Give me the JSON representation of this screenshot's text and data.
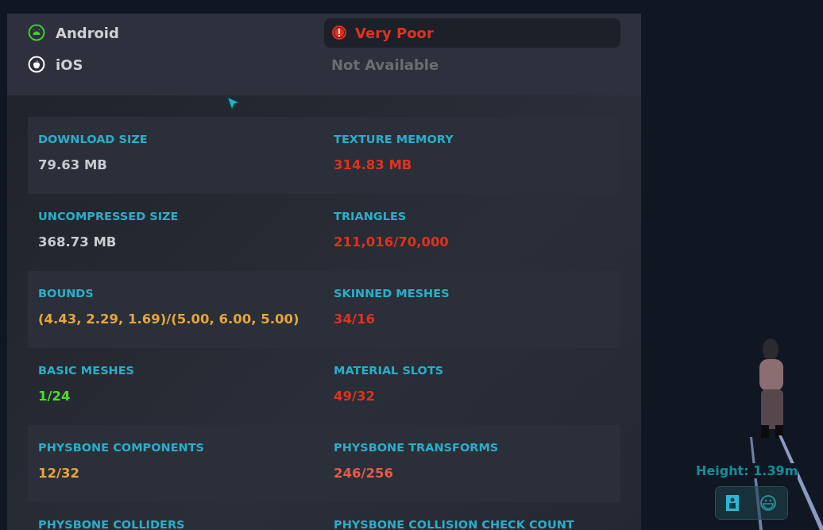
{
  "platforms": [
    {
      "kind": "android",
      "name": "Android",
      "color": "#e0321e",
      "status": "Very Poor",
      "alert": true
    },
    {
      "kind": "ios",
      "name": "iOS",
      "color": "#6b6d73",
      "status": "Not Available",
      "alert": false
    }
  ],
  "stats": [
    {
      "label": "DOWNLOAD SIZE",
      "value": "79.63 MB",
      "color": "#c9cbcf"
    },
    {
      "label": "TEXTURE MEMORY",
      "value": "314.83 MB",
      "color": "#e0321e"
    },
    {
      "label": "UNCOMPRESSED SIZE",
      "value": "368.73 MB",
      "color": "#c9cbcf"
    },
    {
      "label": "TRIANGLES",
      "value": "211,016/70,000",
      "color": "#e0321e"
    },
    {
      "label": "BOUNDS",
      "value": "(4.43, 2.29, 1.69)/(5.00, 6.00, 5.00)",
      "color": "#e8a63a"
    },
    {
      "label": "SKINNED MESHES",
      "value": "34/16",
      "color": "#e0321e"
    },
    {
      "label": "BASIC MESHES",
      "value": "1/24",
      "color": "#4bdc2b"
    },
    {
      "label": "MATERIAL SLOTS",
      "value": "49/32",
      "color": "#e0321e"
    },
    {
      "label": "PHYSBONE COMPONENTS",
      "value": "12/32",
      "color": "#e8a63a"
    },
    {
      "label": "PHYSBONE TRANSFORMS",
      "value": "246/256",
      "color": "#e85a4a"
    },
    {
      "label": "PHYSBONE COLLIDERS"
    },
    {
      "label": "PHYSBONE COLLISION CHECK COUNT"
    }
  ],
  "preview": {
    "height": "Height: 1.39m",
    "modes": [
      {
        "kind": "info",
        "selected": true
      },
      {
        "kind": "face",
        "selected": false
      }
    ]
  }
}
